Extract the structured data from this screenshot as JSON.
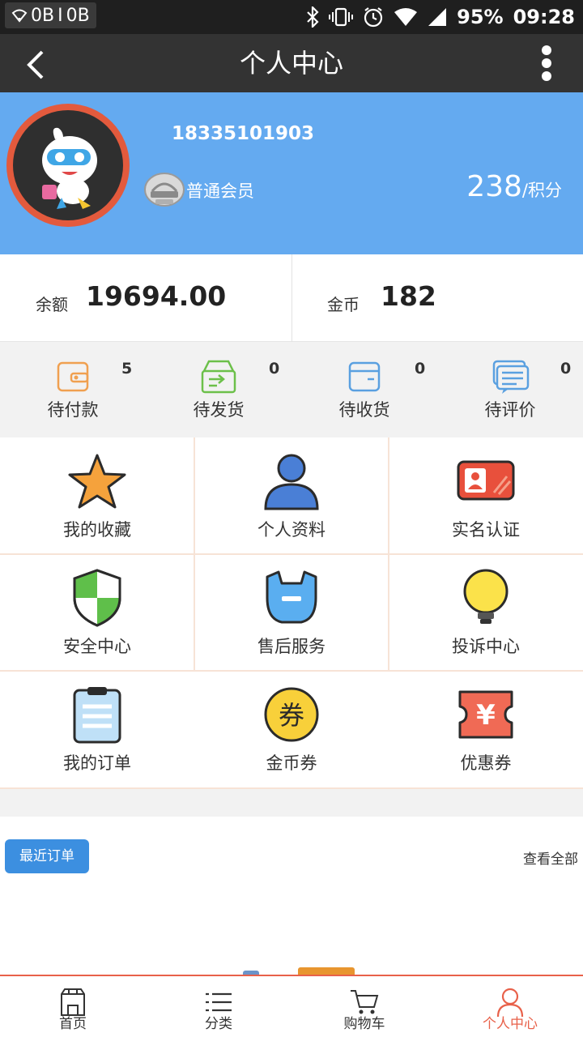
{
  "status_bar": {
    "speed_left": "0B",
    "speed_separator": "I",
    "speed_right": "0B",
    "battery": "95%",
    "time": "09:28"
  },
  "header": {
    "title": "个人中心"
  },
  "profile": {
    "phone": "18335101903",
    "member_level": "普通会员",
    "points_value": "238",
    "points_unit": "/积分"
  },
  "balance": {
    "balance_label": "余额",
    "balance_value": "19694.00",
    "coins_label": "金币",
    "coins_value": "182"
  },
  "order_status": [
    {
      "label": "待付款",
      "count": "5",
      "icon": "wallet-icon",
      "color": "#f0a050"
    },
    {
      "label": "待发货",
      "count": "0",
      "icon": "shipping-box-icon",
      "color": "#6cc04a"
    },
    {
      "label": "待收货",
      "count": "0",
      "icon": "receive-box-icon",
      "color": "#5aa0e0"
    },
    {
      "label": "待评价",
      "count": "0",
      "icon": "comment-icon",
      "color": "#5aa0e0"
    }
  ],
  "menu": [
    {
      "label": "我的收藏",
      "icon": "star-icon"
    },
    {
      "label": "个人资料",
      "icon": "person-icon"
    },
    {
      "label": "实名认证",
      "icon": "id-card-icon"
    },
    {
      "label": "安全中心",
      "icon": "shield-icon"
    },
    {
      "label": "售后服务",
      "icon": "wrench-icon"
    },
    {
      "label": "投诉中心",
      "icon": "lightbulb-icon"
    },
    {
      "label": "我的订单",
      "icon": "clipboard-icon"
    },
    {
      "label": "金币券",
      "icon": "coin-voucher-icon"
    },
    {
      "label": "优惠券",
      "icon": "coupon-icon"
    }
  ],
  "recent_orders": {
    "button_label": "最近订单",
    "view_all": "查看全部"
  },
  "tabbar": [
    {
      "label": "首页",
      "icon": "home-icon",
      "active": false
    },
    {
      "label": "分类",
      "icon": "list-icon",
      "active": false
    },
    {
      "label": "购物车",
      "icon": "cart-icon",
      "active": false
    },
    {
      "label": "个人中心",
      "icon": "user-icon",
      "active": true
    }
  ],
  "colors": {
    "profile_bg": "#64aaf0",
    "titlebar_bg": "#333333",
    "accent": "#e8614a",
    "button_blue": "#3c8fe0"
  }
}
